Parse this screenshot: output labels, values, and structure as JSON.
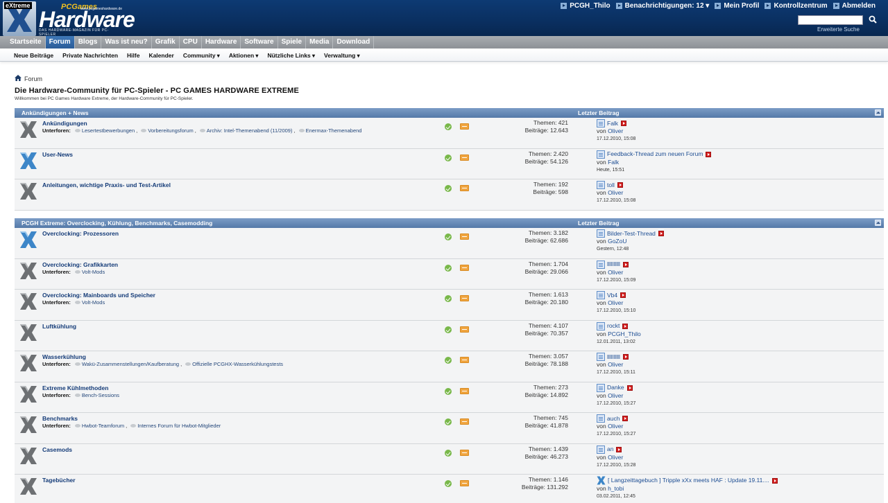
{
  "header": {
    "logo_extreme": "eXtreme",
    "logo_pcgames": "PCGames",
    "logo_url": "www.pcgameshardware.de",
    "logo_main": "Hardware",
    "logo_tagline": "DAS HARDWARE-MAGAZIN FÜR PC-SPIELER",
    "user_nav": [
      {
        "label": "PCGH_Thilo",
        "dropdown": false
      },
      {
        "label": "Benachrichtigungen: 12",
        "dropdown": true
      },
      {
        "label": "Mein Profil",
        "dropdown": false
      },
      {
        "label": "Kontrollzentrum",
        "dropdown": false
      },
      {
        "label": "Abmelden",
        "dropdown": false
      }
    ],
    "search_placeholder": "",
    "advanced_search": "Erweiterte Suche"
  },
  "main_nav": {
    "tabs": [
      "Startseite",
      "Forum",
      "Blogs",
      "Was ist neu?",
      "Grafik",
      "CPU",
      "Hardware",
      "Software",
      "Spiele",
      "Media",
      "Download"
    ],
    "active": "Forum"
  },
  "sub_nav": {
    "items": [
      {
        "label": "Neue Beiträge",
        "dropdown": false
      },
      {
        "label": "Private Nachrichten",
        "dropdown": false
      },
      {
        "label": "Hilfe",
        "dropdown": false
      },
      {
        "label": "Kalender",
        "dropdown": false
      },
      {
        "label": "Community",
        "dropdown": true
      },
      {
        "label": "Aktionen",
        "dropdown": true
      },
      {
        "label": "Nützliche Links",
        "dropdown": true
      },
      {
        "label": "Verwaltung",
        "dropdown": true
      }
    ]
  },
  "breadcrumb": {
    "label": "Forum"
  },
  "page": {
    "title": "Die Hardware-Community für PC-Spieler - PC GAMES HARDWARE EXTREME",
    "description": "Willkommen bei PC Games Hardware Extreme, der Hardware-Community für PC-Spieler."
  },
  "colors": {
    "header_bg": "#0a2f60",
    "active_tab": "#2f67a8",
    "category_header": "#6688b6",
    "link": "#143b78",
    "new_post_icon": "#d42020",
    "status_ok": "#79b84a",
    "rss": "#f0a540"
  },
  "categories": [
    {
      "title": "Ankündigungen + News",
      "last_post_header": "Letzter Beitrag",
      "forums": [
        {
          "name": "Ankündigungen",
          "icon": "grey",
          "subforums_label": "Unterforen:",
          "subforums": [
            "Lesertestbewerbungen",
            "Vorbereitungsforum",
            "Archiv: Intel-Themenabend (11/2009)",
            "Enermax-Themenabend"
          ],
          "threads": "Themen: 421",
          "posts": "Beiträge: 12.643",
          "last_title": "Falk",
          "last_by": "Oliver",
          "last_date": "17.12.2010, 15:08",
          "last_icon": "doc"
        },
        {
          "name": "User-News",
          "icon": "blue",
          "subforums_label": "",
          "subforums": [],
          "threads": "Themen: 2.420",
          "posts": "Beiträge: 54.126",
          "last_title": "Feedback-Thread zum neuen Forum",
          "last_by": "Falk",
          "last_date": "Heute, 15:51",
          "last_icon": "doc"
        },
        {
          "name": "Anleitungen, wichtige Praxis- und Test-Artikel",
          "icon": "grey",
          "subforums_label": "",
          "subforums": [],
          "threads": "Themen: 192",
          "posts": "Beiträge: 598",
          "last_title": "toll",
          "last_by": "Oliver",
          "last_date": "17.12.2010, 15:08",
          "last_icon": "doc"
        }
      ]
    },
    {
      "title": "PCGH Extreme: Overclocking, Kühlung, Benchmarks, Casemodding",
      "last_post_header": "Letzter Beitrag",
      "forums": [
        {
          "name": "Overclocking: Prozessoren",
          "icon": "blue",
          "subforums_label": "",
          "subforums": [],
          "threads": "Themen: 3.182",
          "posts": "Beiträge: 62.686",
          "last_title": "Bilder-Test-Thread",
          "last_by": "GoZoU",
          "last_date": "Gestern, 12:48",
          "last_icon": "doc"
        },
        {
          "name": "Overclocking: Grafikkarten",
          "icon": "grey",
          "subforums_label": "Unterforen:",
          "subforums": [
            "Volt-Mods"
          ],
          "threads": "Themen: 1.704",
          "posts": "Beiträge: 29.066",
          "last_title": "llllllllll",
          "last_by": "Oliver",
          "last_date": "17.12.2010, 15:09",
          "last_icon": "doc"
        },
        {
          "name": "Overclocking: Mainboards und Speicher",
          "icon": "grey",
          "subforums_label": "Unterforen:",
          "subforums": [
            "Volt-Mods"
          ],
          "threads": "Themen: 1.613",
          "posts": "Beiträge: 20.180",
          "last_title": "Vb4",
          "last_by": "Oliver",
          "last_date": "17.12.2010, 15:10",
          "last_icon": "doc"
        },
        {
          "name": "Luftkühlung",
          "icon": "grey",
          "subforums_label": "",
          "subforums": [],
          "threads": "Themen: 4.107",
          "posts": "Beiträge: 70.357",
          "last_title": "rockt",
          "last_by": "PCGH_Thilo",
          "last_date": "12.01.2011, 13:02",
          "last_icon": "doc"
        },
        {
          "name": "Wasserkühlung",
          "icon": "grey",
          "subforums_label": "Unterforen:",
          "subforums": [
            "Wakü-Zusammenstellungen/Kaufberatung",
            "Offizielle PCGHX-Wasserkühlungstests"
          ],
          "threads": "Themen: 3.057",
          "posts": "Beiträge: 78.188",
          "last_title": "llllllllll",
          "last_by": "Oliver",
          "last_date": "17.12.2010, 15:11",
          "last_icon": "doc"
        },
        {
          "name": "Extreme Kühlmethoden",
          "icon": "grey",
          "subforums_label": "Unterforen:",
          "subforums": [
            "Bench-Sessions"
          ],
          "threads": "Themen: 273",
          "posts": "Beiträge: 14.892",
          "last_title": "Danke",
          "last_by": "Oliver",
          "last_date": "17.12.2010, 15:27",
          "last_icon": "doc"
        },
        {
          "name": "Benchmarks",
          "icon": "grey",
          "subforums_label": "Unterforen:",
          "subforums": [
            "Hwbot-Teamforum",
            "Internes Forum für Hwbot-Mitglieder"
          ],
          "threads": "Themen: 745",
          "posts": "Beiträge: 41.878",
          "last_title": "auch",
          "last_by": "Oliver",
          "last_date": "17.12.2010, 15:27",
          "last_icon": "doc"
        },
        {
          "name": "Casemods",
          "icon": "grey",
          "subforums_label": "",
          "subforums": [],
          "threads": "Themen: 1.439",
          "posts": "Beiträge: 46.273",
          "last_title": "an",
          "last_by": "Oliver",
          "last_date": "17.12.2010, 15:28",
          "last_icon": "doc"
        },
        {
          "name": "Tagebücher",
          "icon": "grey",
          "subforums_label": "",
          "subforums": [],
          "threads": "Themen: 1.146",
          "posts": "Beiträge: 131.292",
          "last_title": "[ Langzeittagebuch ] Tripple xXx meets HAF : Update 19.11....",
          "last_by": "h_tobi",
          "last_date": "03.02.2011, 12:45",
          "last_icon": "x"
        }
      ]
    }
  ]
}
